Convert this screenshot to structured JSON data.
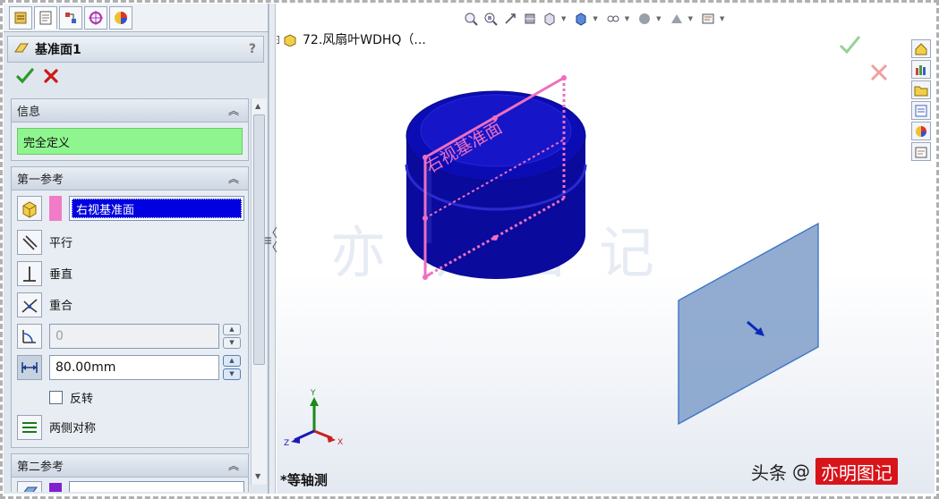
{
  "feature": {
    "title": "基准面1",
    "help": "?"
  },
  "groups": {
    "info": {
      "label": "信息",
      "status": "完全定义"
    },
    "first_ref": {
      "label": "第一参考",
      "selection": "右视基准面",
      "options": {
        "parallel": "平行",
        "perpendicular": "垂直",
        "coincident": "重合"
      },
      "angle_value": "0",
      "distance_value": "80.00mm",
      "flip_label": "反转",
      "symmetric_label": "两侧对称"
    },
    "second_ref": {
      "label": "第二参考"
    }
  },
  "tree": {
    "toggle": "+",
    "label": "72.风扇叶WDHQ（..."
  },
  "scene": {
    "plane_label": "右视基准面",
    "view_name": "*等轴测",
    "triad": {
      "x": "X",
      "y": "Y",
      "z": "Z"
    }
  },
  "credit": {
    "prefix": "头条",
    "handle": "@",
    "brand": "亦明图记"
  },
  "watermark": "亦明图记",
  "colors": {
    "part_blue": "#0a0a9c",
    "plane_pink": "#ee6fc0",
    "preview_plane": "#7f9ec9",
    "status_green": "#8ff58f",
    "selection_blue": "#0000e0",
    "ok_green": "#2a9a2a",
    "cancel_red": "#d01818"
  },
  "icons": {
    "ok": "check-icon",
    "cancel": "cross-icon",
    "parallel": "parallel-icon",
    "perpendicular": "perpendicular-icon",
    "coincident": "coincident-icon",
    "angle": "angle-icon",
    "distance": "distance-icon",
    "symmetric": "symmetric-icon"
  }
}
